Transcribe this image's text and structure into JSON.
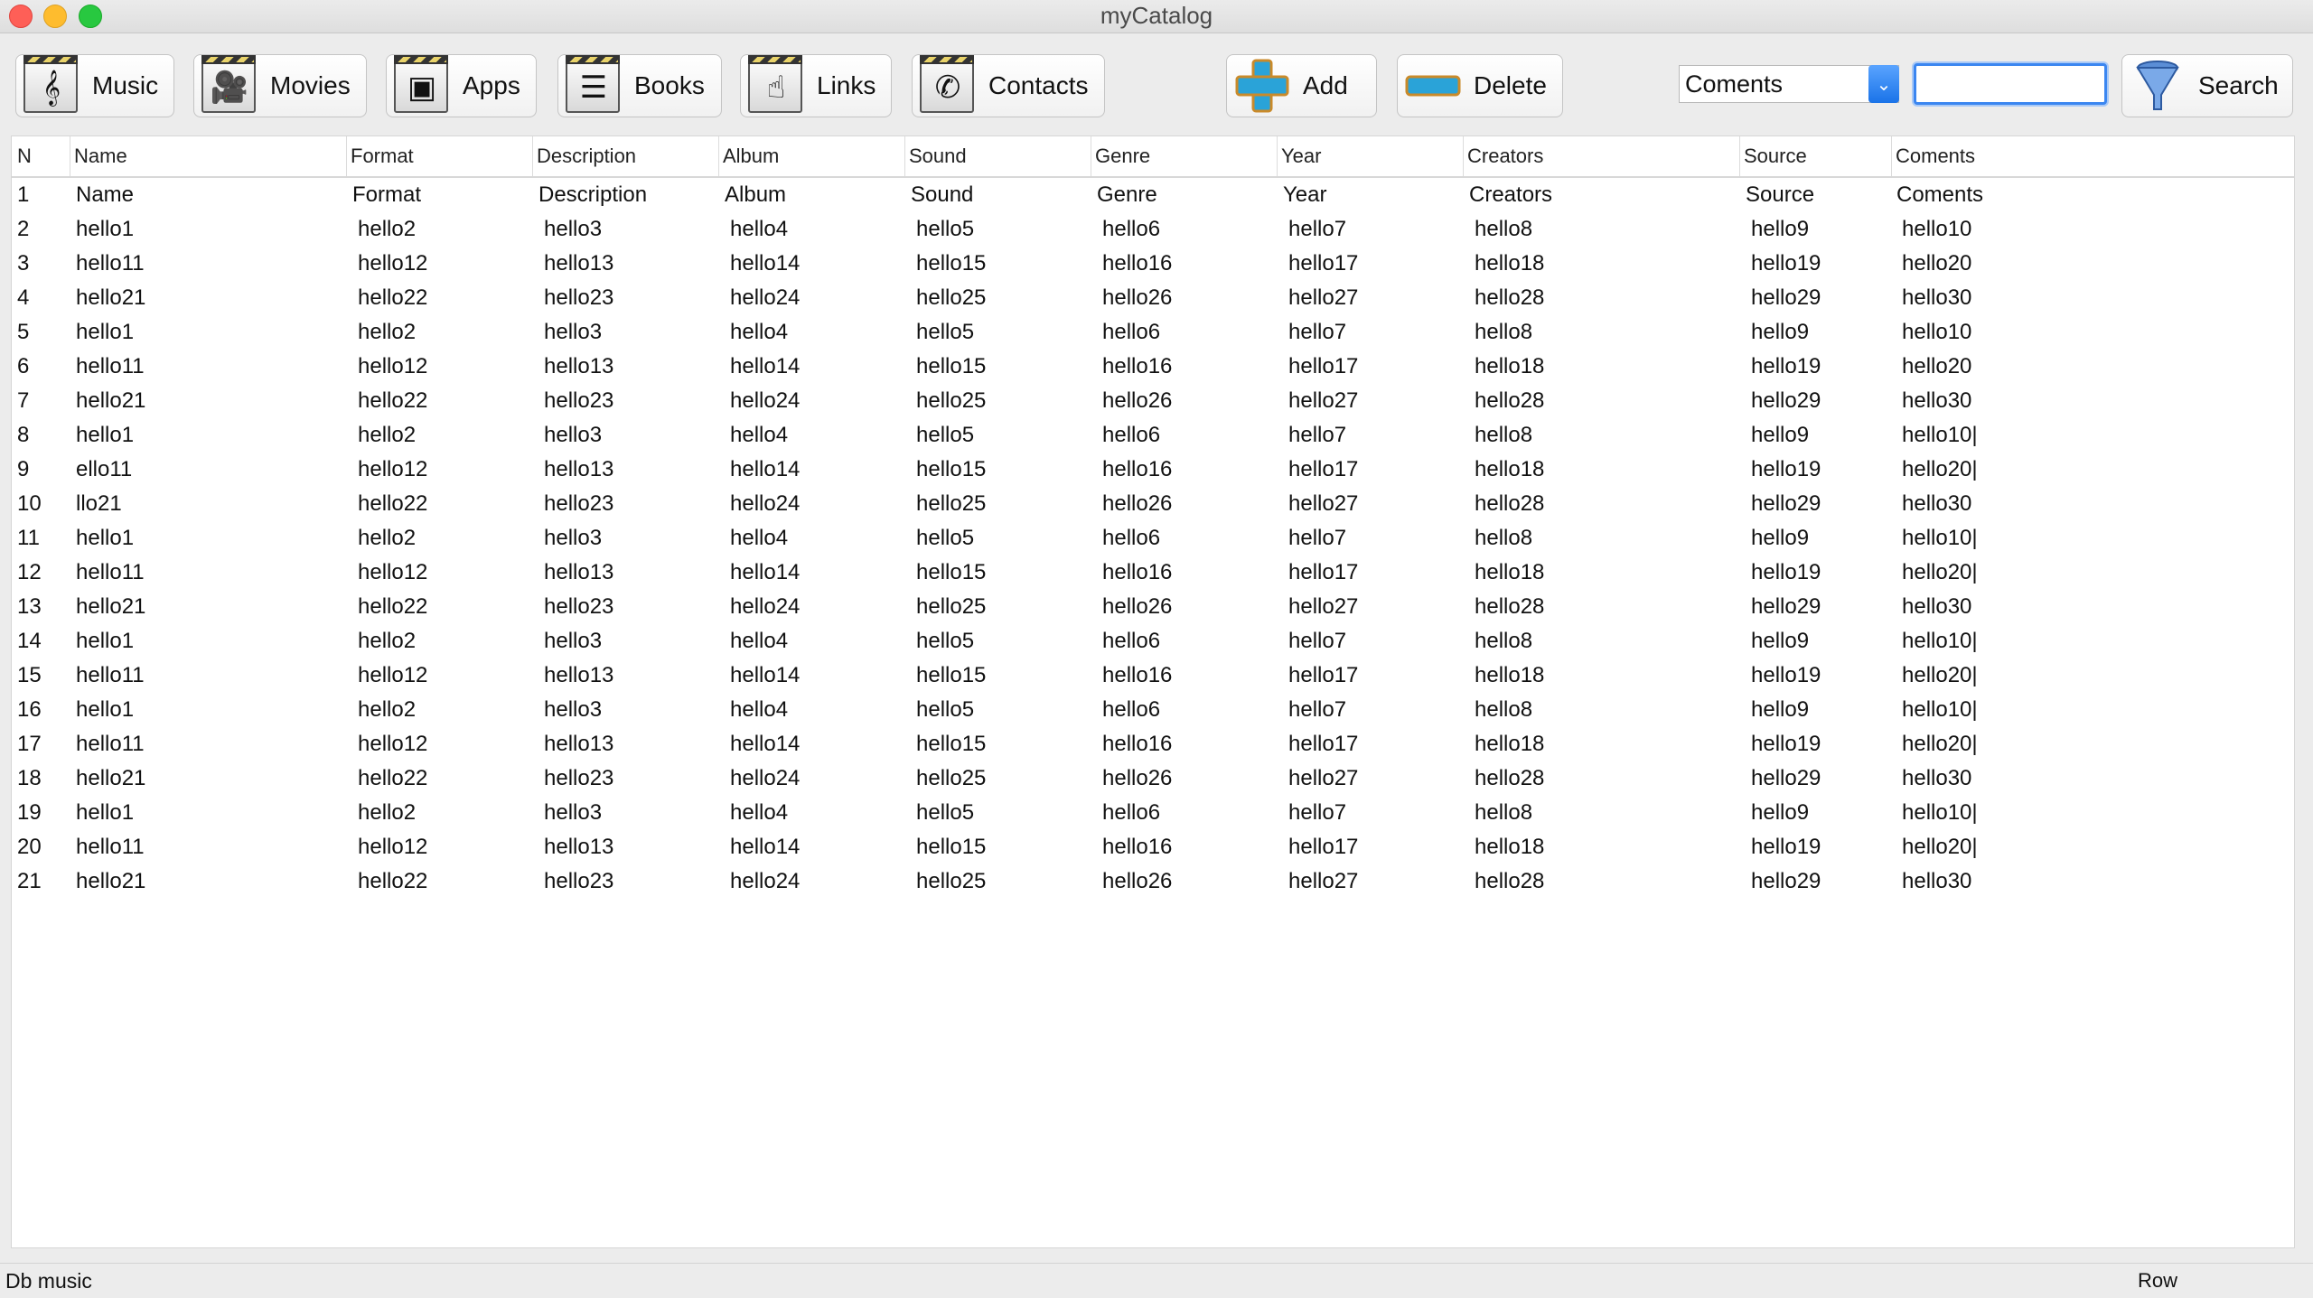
{
  "window": {
    "title": "myCatalog"
  },
  "toolbar": {
    "categories": [
      {
        "label": "Music",
        "icon": "music-note-icon"
      },
      {
        "label": "Movies",
        "icon": "movie-camera-icon"
      },
      {
        "label": "Apps",
        "icon": "apps-icon"
      },
      {
        "label": "Books",
        "icon": "books-icon"
      },
      {
        "label": "Links",
        "icon": "links-icon"
      },
      {
        "label": "Contacts",
        "icon": "phone-icon"
      }
    ],
    "add_label": "Add",
    "delete_label": "Delete",
    "search_field_select": "Coments",
    "search_value": "",
    "search_label": "Search"
  },
  "table": {
    "columns": [
      "N",
      "Name",
      "Format",
      "Description",
      "Album",
      "Sound",
      "Genre",
      "Year",
      "Creators",
      "Source",
      "Coments"
    ],
    "rows": [
      [
        "1",
        "Name",
        "Format",
        "Description",
        "Album",
        "Sound",
        "Genre",
        "Year",
        "Creators",
        "Source",
        "Coments"
      ],
      [
        "2",
        "hello1",
        "hello2",
        "hello3",
        "hello4",
        "hello5",
        "hello6",
        "hello7",
        "hello8",
        "hello9",
        "hello10"
      ],
      [
        "3",
        "hello11",
        "hello12",
        "hello13",
        "hello14",
        "hello15",
        "hello16",
        "hello17",
        "hello18",
        "hello19",
        "hello20"
      ],
      [
        "4",
        "hello21",
        "hello22",
        "hello23",
        "hello24",
        "hello25",
        "hello26",
        "hello27",
        "hello28",
        "hello29",
        "hello30"
      ],
      [
        "5",
        "hello1",
        "hello2",
        "hello3",
        "hello4",
        "hello5",
        "hello6",
        "hello7",
        "hello8",
        "hello9",
        "hello10"
      ],
      [
        "6",
        "hello11",
        "hello12",
        "hello13",
        "hello14",
        "hello15",
        "hello16",
        "hello17",
        "hello18",
        "hello19",
        "hello20"
      ],
      [
        "7",
        "hello21",
        "hello22",
        "hello23",
        "hello24",
        "hello25",
        "hello26",
        "hello27",
        "hello28",
        "hello29",
        "hello30"
      ],
      [
        "8",
        "hello1",
        "hello2",
        "hello3",
        "hello4",
        "hello5",
        "hello6",
        "hello7",
        "hello8",
        "hello9",
        "hello10|"
      ],
      [
        "9",
        "ello11",
        "hello12",
        "hello13",
        "hello14",
        "hello15",
        "hello16",
        "hello17",
        "hello18",
        "hello19",
        "hello20|"
      ],
      [
        "10",
        "llo21",
        "hello22",
        "hello23",
        "hello24",
        "hello25",
        "hello26",
        "hello27",
        "hello28",
        "hello29",
        "hello30"
      ],
      [
        "11",
        "hello1",
        "hello2",
        "hello3",
        "hello4",
        "hello5",
        "hello6",
        "hello7",
        "hello8",
        "hello9",
        "hello10|"
      ],
      [
        "12",
        "hello11",
        "hello12",
        "hello13",
        "hello14",
        "hello15",
        "hello16",
        "hello17",
        "hello18",
        "hello19",
        "hello20|"
      ],
      [
        "13",
        "hello21",
        "hello22",
        "hello23",
        "hello24",
        "hello25",
        "hello26",
        "hello27",
        "hello28",
        "hello29",
        "hello30"
      ],
      [
        "14",
        "hello1",
        "hello2",
        "hello3",
        "hello4",
        "hello5",
        "hello6",
        "hello7",
        "hello8",
        "hello9",
        "hello10|"
      ],
      [
        "15",
        "hello11",
        "hello12",
        "hello13",
        "hello14",
        "hello15",
        "hello16",
        "hello17",
        "hello18",
        "hello19",
        "hello20|"
      ],
      [
        "16",
        "hello1",
        "hello2",
        "hello3",
        "hello4",
        "hello5",
        "hello6",
        "hello7",
        "hello8",
        "hello9",
        "hello10|"
      ],
      [
        "17",
        "hello11",
        "hello12",
        "hello13",
        "hello14",
        "hello15",
        "hello16",
        "hello17",
        "hello18",
        "hello19",
        "hello20|"
      ],
      [
        "18",
        "hello21",
        "hello22",
        "hello23",
        "hello24",
        "hello25",
        "hello26",
        "hello27",
        "hello28",
        "hello29",
        "hello30"
      ],
      [
        "19",
        "hello1",
        "hello2",
        "hello3",
        "hello4",
        "hello5",
        "hello6",
        "hello7",
        "hello8",
        "hello9",
        "hello10|"
      ],
      [
        "20",
        "hello11",
        "hello12",
        "hello13",
        "hello14",
        "hello15",
        "hello16",
        "hello17",
        "hello18",
        "hello19",
        "hello20|"
      ],
      [
        "21",
        "hello21",
        "hello22",
        "hello23",
        "hello24",
        "hello25",
        "hello26",
        "hello27",
        "hello28",
        "hello29",
        "hello30"
      ]
    ]
  },
  "status": {
    "left": "Db music",
    "right": "Row"
  }
}
